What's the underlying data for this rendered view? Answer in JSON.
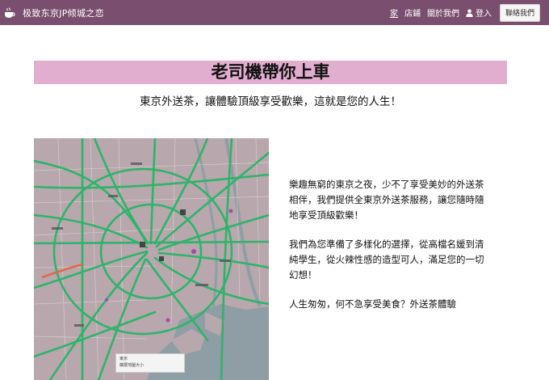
{
  "navbar": {
    "brand": "极致东京JP倾城之恋",
    "links": [
      "家",
      "店鋪",
      "關於我們"
    ],
    "login": "登入",
    "contact_button": "聯絡我們"
  },
  "hero": {
    "title": "老司機帶你上車",
    "subtitle": "東京外送茶，讓體驗頂級享受歡樂，這就是您的人生！"
  },
  "map": {
    "popup_lines": [
      "東京",
      "擴展地圖大小"
    ]
  },
  "intro": {
    "paragraphs": [
      "樂趣無窮的東京之夜，少不了享受美妙的外送茶相伴，我們提供全東京外送茶服務，讓您隨時隨地享受頂級歡樂！",
      "我們為您準備了多樣化的選擇，從高檔名媛到清純學生，從火辣性感的造型可人，滿足您的一切幻想！",
      "人生匆匆，何不急享受美食？外送茶體驗"
    ]
  },
  "colors": {
    "navbar": "#7a4e6e",
    "title_band": "#e2aed0",
    "map_roads": "#2fb36b",
    "map_water": "#8f9ea5"
  }
}
